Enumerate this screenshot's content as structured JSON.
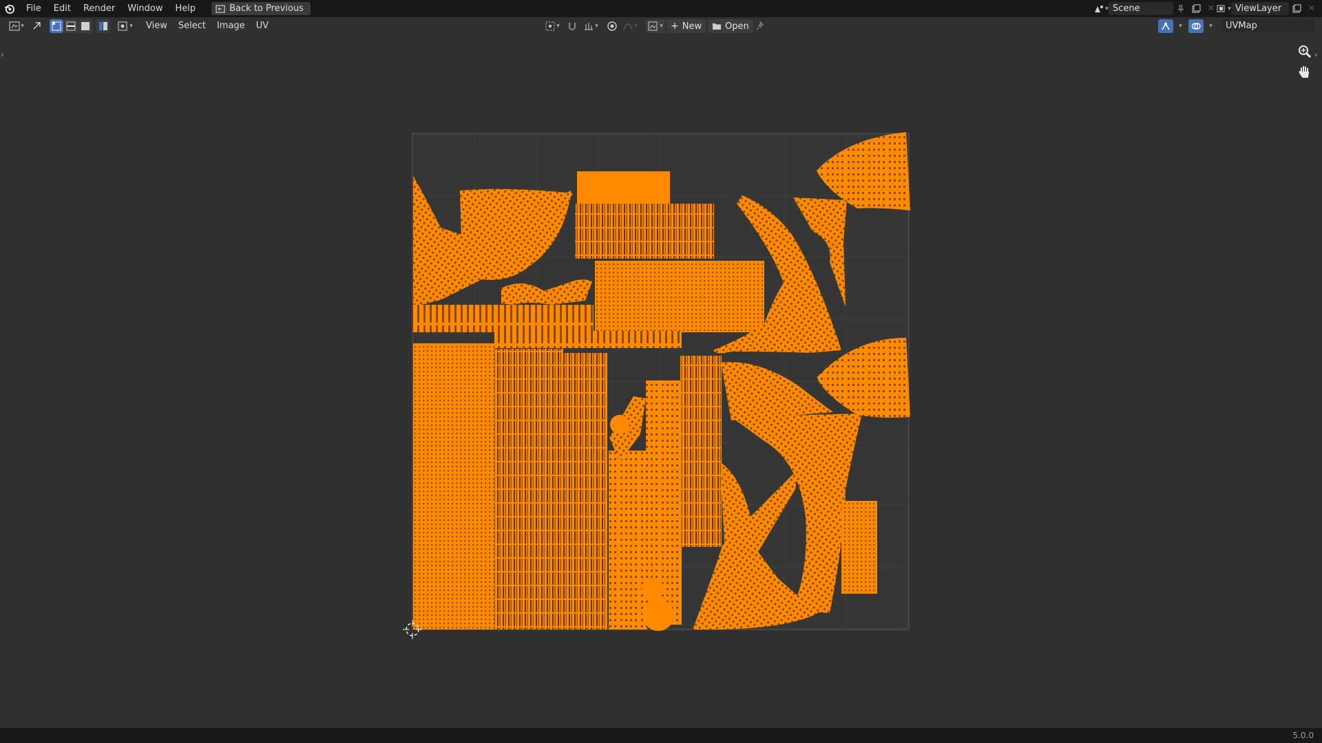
{
  "topbar": {
    "menus": [
      "File",
      "Edit",
      "Render",
      "Window",
      "Help"
    ],
    "back_label": "Back to Previous",
    "scene": "Scene",
    "view_layer": "ViewLayer"
  },
  "editor_header": {
    "menus": [
      "View",
      "Select",
      "Image",
      "UV"
    ],
    "new_label": "New",
    "open_label": "Open",
    "uv_map": "UVMap"
  },
  "status_bar": {
    "version": "5.0.0"
  },
  "colors": {
    "uv_edges": "#ff8a00",
    "background": "#303030",
    "header": "#181818",
    "accent": "#4772b3"
  },
  "icons": [
    "blender-logo-icon",
    "back-icon",
    "editor-type-icon",
    "sync-selection-icon",
    "vertex-select-icon",
    "edge-select-icon",
    "face-select-icon",
    "island-select-icon",
    "sticky-mode-icon",
    "pivot-icon",
    "snap-icon",
    "proportional-icon",
    "image-browse-icon",
    "plus-icon",
    "folder-icon",
    "pin-icon",
    "gizmo-icon",
    "overlay-icon",
    "zoom-icon",
    "hand-icon",
    "2d-cursor-icon"
  ]
}
